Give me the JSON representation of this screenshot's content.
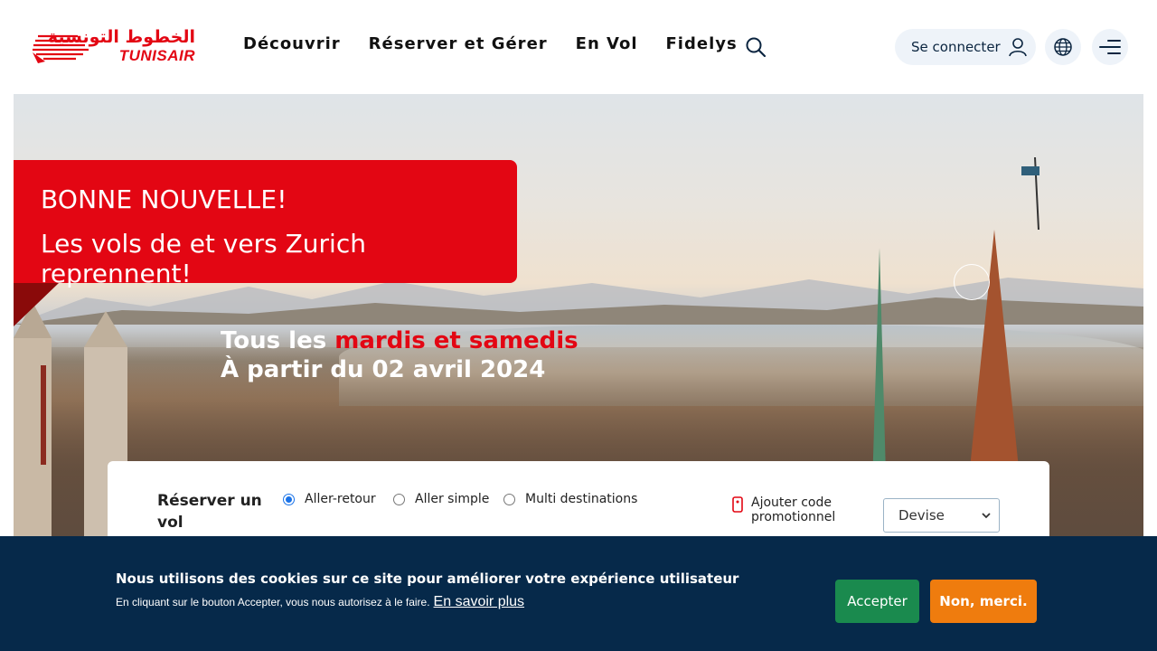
{
  "header": {
    "logo": {
      "arabic": "الخطوط التونسية",
      "latin": "TUNISAIR"
    },
    "nav": [
      {
        "label": "Découvrir"
      },
      {
        "label": "Réserver et Gérer"
      },
      {
        "label": "En Vol"
      },
      {
        "label": "Fidelys"
      }
    ],
    "login_label": "Se connecter",
    "icons": {
      "search": "search-icon",
      "user": "user-icon",
      "language": "globe-icon",
      "menu": "menu-icon"
    }
  },
  "hero": {
    "banner_line1": "BONNE NOUVELLE!",
    "banner_line2": "Les vols de et vers Zurich reprennent!",
    "line1_prefix": "Tous les ",
    "line1_highlight": "mardis et samedis",
    "line2": "À partir du 02 avril 2024"
  },
  "booking": {
    "title": "Réserver un vol",
    "trip_types": [
      {
        "label": "Aller-retour",
        "selected": true
      },
      {
        "label": "Aller simple",
        "selected": false
      },
      {
        "label": "Multi destinations",
        "selected": false
      }
    ],
    "promo_label_1": "Ajouter code",
    "promo_label_2": "promotionnel",
    "currency_value": "Devise"
  },
  "cookie": {
    "title": "Nous utilisons des cookies sur ce site pour améliorer votre expérience utilisateur",
    "subtitle": "En cliquant sur le bouton Accepter, vous nous autorisez à le faire.",
    "link": "En savoir plus",
    "accept": "Accepter",
    "decline": "Non, merci."
  },
  "colors": {
    "brand_red": "#e30613",
    "navy": "#06294a",
    "accept_green": "#1a8a4e",
    "decline_orange": "#ef7c0e"
  }
}
